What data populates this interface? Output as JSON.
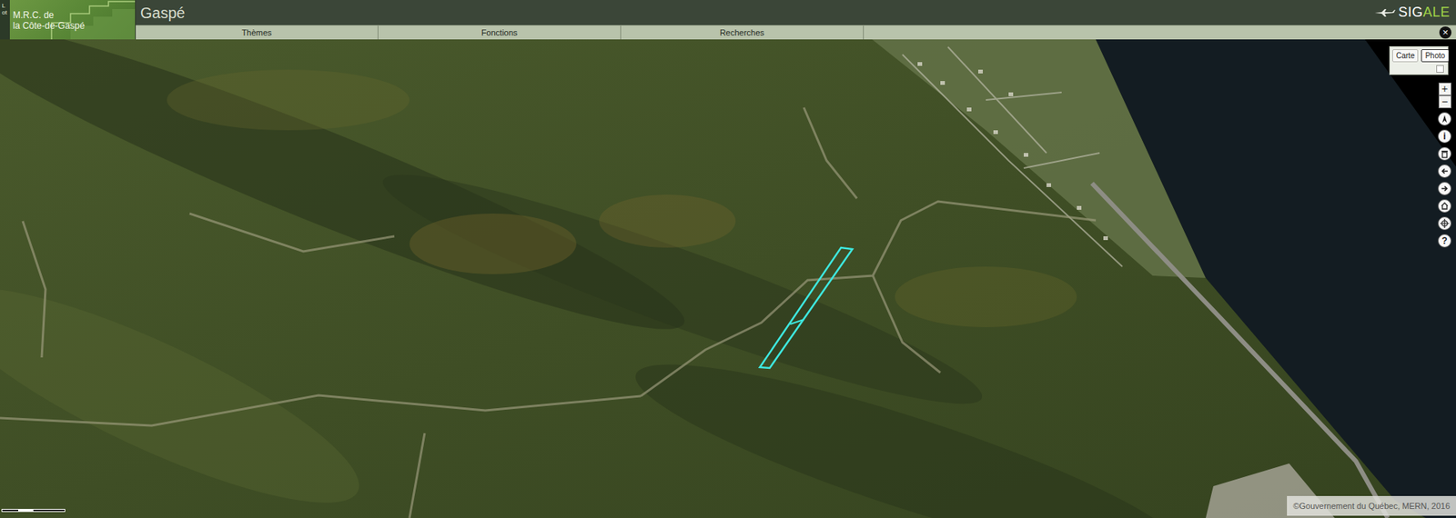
{
  "logo": {
    "tab": "Lot",
    "lines": [
      "M.R.C. de",
      "la Côte-de-Gaspé"
    ]
  },
  "window": {
    "title": "Gaspé"
  },
  "brand": {
    "prefix": "SIG",
    "suffix": "ALE"
  },
  "menu": [
    "Thèmes",
    "Fonctions",
    "Recherches"
  ],
  "close": "×",
  "view_toggle": [
    {
      "label": "Carte",
      "selected": false
    },
    {
      "label": "Photo",
      "selected": true
    }
  ],
  "overlay_checkbox": {
    "checked": false
  },
  "zoom": {
    "in": "+",
    "out": "−"
  },
  "tools": {
    "info": "i",
    "help": "?"
  },
  "copyright": "©Gouvernement du Québec, MERN, 2016"
}
